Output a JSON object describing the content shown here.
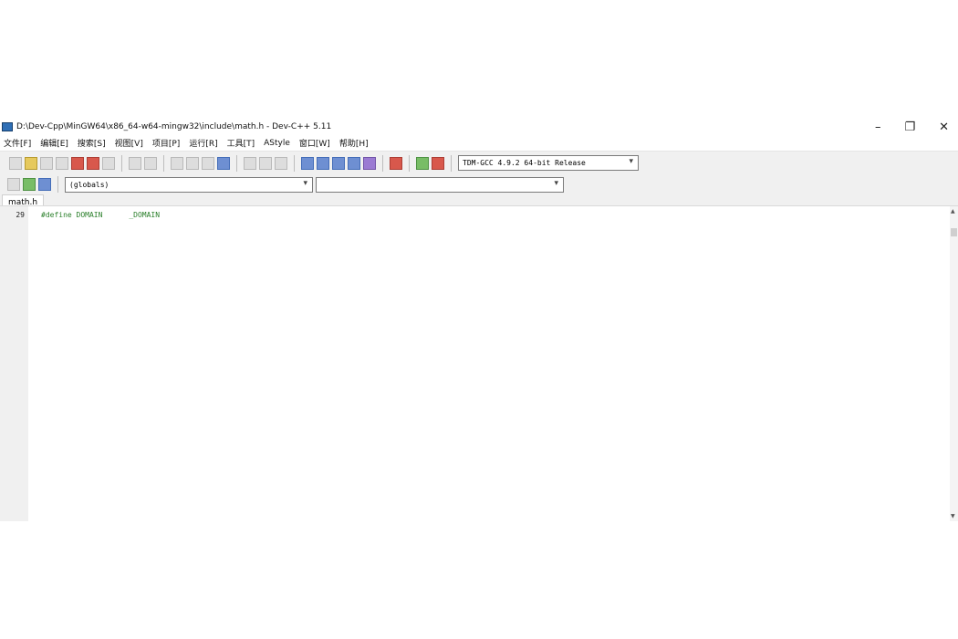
{
  "window": {
    "title": "D:\\Dev-Cpp\\MinGW64\\x86_64-w64-mingw32\\include\\math.h - Dev-C++ 5.11",
    "minimize": "–",
    "restore": "❐",
    "close": "✕"
  },
  "menu": [
    "文件[F]",
    "编辑[E]",
    "搜索[S]",
    "视图[V]",
    "项目[P]",
    "运行[R]",
    "工具[T]",
    "AStyle",
    "窗口[W]",
    "帮助[H]"
  ],
  "compiler": "TDM-GCC 4.9.2 64-bit Release",
  "scope": "(globals)",
  "members": "",
  "tab": "math.h",
  "code": {
    "first_line": "#define DOMAIN      _DOMAIN"
  }
}
